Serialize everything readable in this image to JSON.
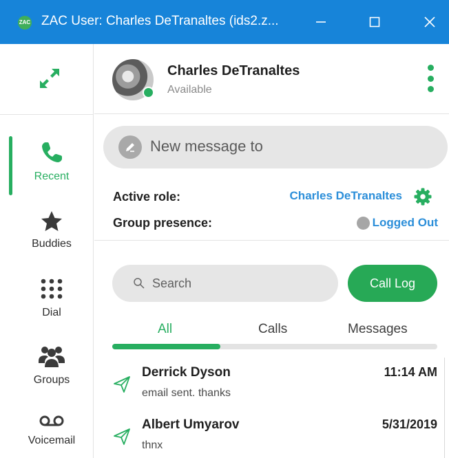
{
  "window": {
    "title": "ZAC User: Charles DeTranaltes (ids2.z...",
    "app_icon_text": "ZAC",
    "minimize_label": "—",
    "maximize_label": "☐",
    "close_label": "✕"
  },
  "colors": {
    "titlebar": "#1784d9",
    "accent_green": "#27ae60",
    "link_blue": "#2b8ed9",
    "presence_offline": "#a6a6a6"
  },
  "sidebar": {
    "expand_icon": "expand-arrows-icon",
    "items": [
      {
        "label": "Recent",
        "icon": "phone-icon",
        "active": true
      },
      {
        "label": "Buddies",
        "icon": "star-icon",
        "active": false
      },
      {
        "label": "Dial",
        "icon": "dialpad-icon",
        "active": false
      },
      {
        "label": "Groups",
        "icon": "groups-icon",
        "active": false
      },
      {
        "label": "Voicemail",
        "icon": "voicemail-icon",
        "active": false
      }
    ]
  },
  "profile": {
    "name": "Charles DeTranaltes",
    "status": "Available"
  },
  "new_message": {
    "placeholder": "New message to"
  },
  "roles": {
    "active_role_label": "Active role:",
    "active_role_value": "Charles DeTranaltes",
    "group_presence_label": "Group presence:",
    "group_presence_value": "Logged Out"
  },
  "search": {
    "placeholder": "Search"
  },
  "call_log_label": "Call Log",
  "tabs": [
    {
      "label": "All",
      "active": true
    },
    {
      "label": "Calls",
      "active": false
    },
    {
      "label": "Messages",
      "active": false
    }
  ],
  "recent_items": [
    {
      "name": "Derrick Dyson",
      "time": "11:14 AM",
      "snippet": "email sent. thanks",
      "icon": "send-icon"
    },
    {
      "name": "Albert Umyarov",
      "time": "5/31/2019",
      "snippet": "thnx",
      "icon": "send-icon"
    }
  ]
}
